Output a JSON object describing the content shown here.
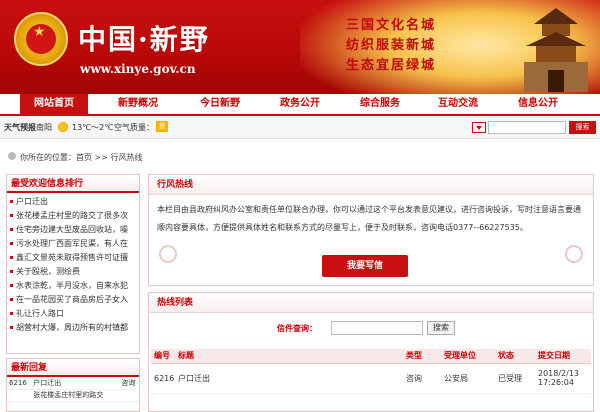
{
  "header": {
    "logo_text": "中国·新野",
    "url": "www.xinye.gov.cn",
    "slogans": [
      "三国文化名城",
      "纺织服装新城",
      "生态宜居绿城"
    ]
  },
  "nav": {
    "items": [
      {
        "label": "网站首页",
        "active": true
      },
      {
        "label": "新野概况"
      },
      {
        "label": "今日新野"
      },
      {
        "label": "政务公开"
      },
      {
        "label": "综合服务"
      },
      {
        "label": "互动交流"
      },
      {
        "label": "信息公开"
      }
    ]
  },
  "utility": {
    "weather_label": "天气预报",
    "city": "南阳",
    "temperature": "13℃～2℃",
    "aqi_label": "空气质量：",
    "aqi_value": "良",
    "search_button": "搜索"
  },
  "breadcrumb": {
    "text": "你所在的位置：首页 >> 行风热线"
  },
  "ranking": {
    "title": "最受欢迎信息排行",
    "items": [
      "户口迁出",
      "张花楼孟庄村里的路交了很多次",
      "住宅旁边建大型废品回收站，噪",
      "污水处理厂西面军民渠，有人在",
      "鑫汇文景苑未取得预售许可证擅",
      "关于殴税，测绘费",
      "水表涂乾，半月没水，自来水犯",
      "在一品花园买了商品房后子女入",
      "礼让行人路口",
      "胡营村大爆，周边所有的村镇都"
    ]
  },
  "latest": {
    "title": "最新回复",
    "rows": [
      [
        "6216",
        "户口迁出",
        "咨询"
      ],
      [
        "",
        "张花楼孟庄村里的路交",
        ""
      ]
    ]
  },
  "hotline": {
    "title": "行风热线",
    "intro": "本栏目由县政府纠风办公室和责任单位联合办理，你可以通过这个平台发表意见建议，进行咨询投诉，写时注意语言要通顺内容要具体，方便提供具体姓名和联系方式的尽量写上，便于及时联系，咨询电话0377--66227535。",
    "write_button": "我要写信"
  },
  "hot_list": {
    "title": "热线列表",
    "query_label": "信件查询：",
    "query_button": "搜索",
    "columns": [
      "编号",
      "标题",
      "类型",
      "受理单位",
      "状态",
      "提交日期"
    ],
    "rows": [
      [
        "6216",
        "户口迁出",
        "咨询",
        "公安局",
        "已受理",
        "2018/2/13 17:26:04"
      ]
    ]
  }
}
